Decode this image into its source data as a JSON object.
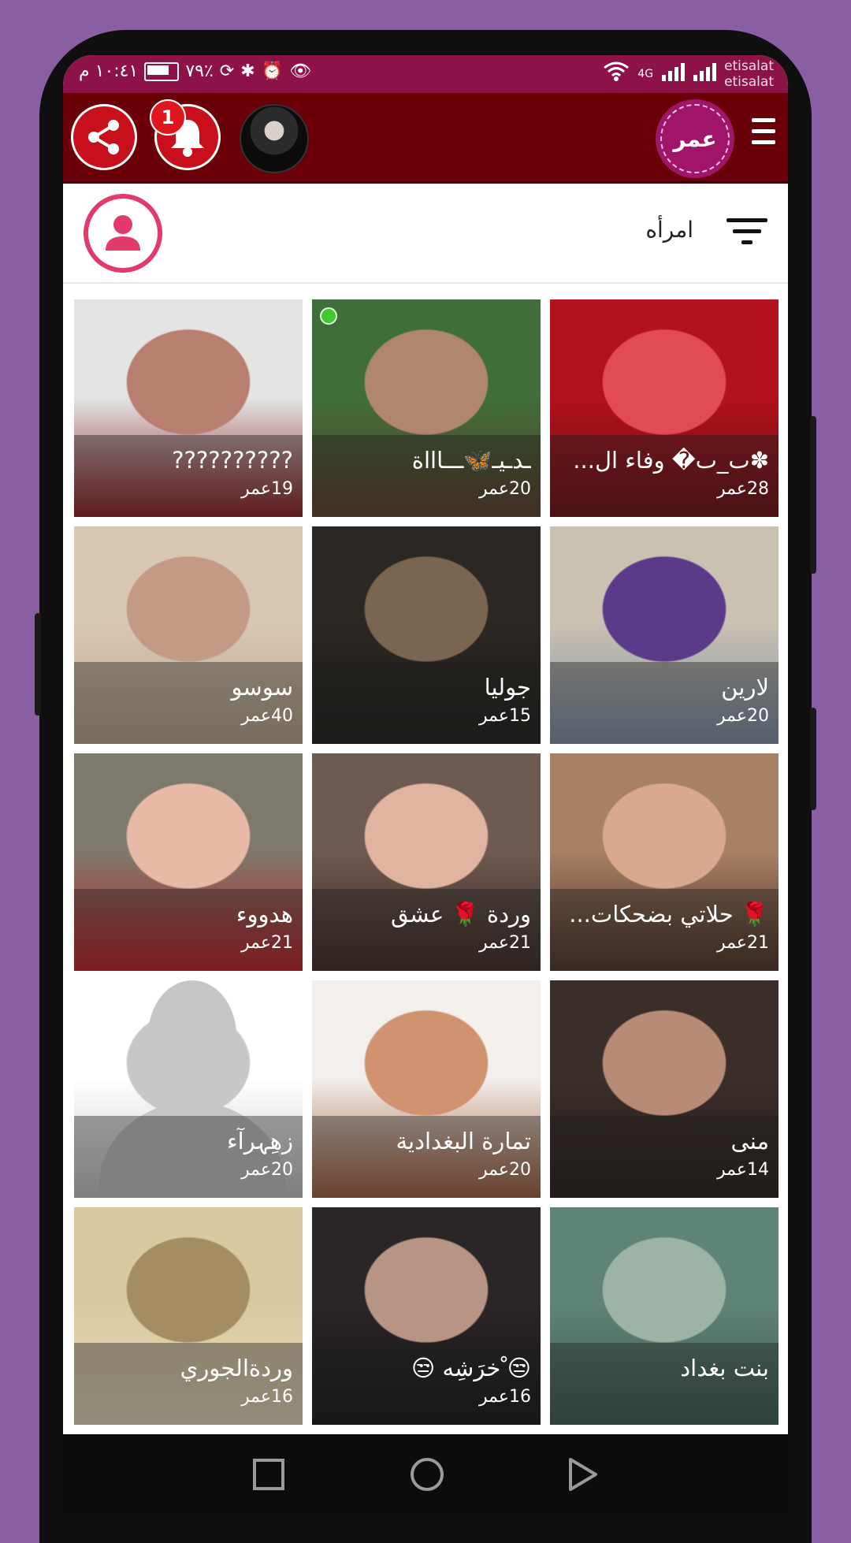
{
  "status_bar": {
    "time": "١٠:٤١ م",
    "battery": "٧٩٪",
    "network": "4G",
    "carriers": [
      "etisalat",
      "etisalat"
    ]
  },
  "header": {
    "brand": "عمر",
    "notification_count": "1"
  },
  "filter": {
    "label": "امرأه"
  },
  "age_suffix": "عمر",
  "profiles": [
    {
      "name": "✽ٮ_ٮ� وفاء ال...",
      "age": "28عمر",
      "colors": [
        "#b2121d",
        "#e24a55",
        "#6b0a0f"
      ]
    },
    {
      "name": "ـدـيـ🦋ـــاااة",
      "age": "20عمر",
      "colors": [
        "#3f6e3a",
        "#b08670",
        "#5a3b2a"
      ],
      "online": true
    },
    {
      "name": "??????????",
      "age": "19عمر",
      "colors": [
        "#e4e4e4",
        "#b87f70",
        "#8a1a1e"
      ]
    },
    {
      "name": "لارين",
      "age": "20عمر",
      "colors": [
        "#c9c1b2",
        "#5b3a8a",
        "#7d8fa4"
      ]
    },
    {
      "name": "جوليا",
      "age": "15عمر",
      "colors": [
        "#2b2722",
        "#7a6650",
        "#1c1a17"
      ]
    },
    {
      "name": "سوسو",
      "age": "40عمر",
      "colors": [
        "#d8c7b3",
        "#c39a85",
        "#b9a78d"
      ]
    },
    {
      "name": "🌹 حلاتي بضحكات...",
      "age": "21عمر",
      "colors": [
        "#a88066",
        "#d9a88e",
        "#4a3125"
      ]
    },
    {
      "name": "وردة 🌹 عشق",
      "age": "21عمر",
      "colors": [
        "#6d5a52",
        "#e0b4a0",
        "#3b2722"
      ]
    },
    {
      "name": "هدووء",
      "age": "21عمر",
      "colors": [
        "#7d7a6d",
        "#e8b9a7",
        "#c21c22"
      ]
    },
    {
      "name": "منى",
      "age": "14عمر",
      "colors": [
        "#3a2e2a",
        "#b88b77",
        "#241a17"
      ]
    },
    {
      "name": "تمارة البغدادية",
      "age": "20عمر",
      "colors": [
        "#f2efec",
        "#d0936f",
        "#a05c3a"
      ]
    },
    {
      "name": "زِهِہرآء",
      "age": "20عمر",
      "placeholder": true,
      "colors": [
        "#ffffff",
        "#c7c7c7",
        "#c7c7c7"
      ]
    },
    {
      "name": "بنت بغداد",
      "age": "",
      "colors": [
        "#5f8376",
        "#9cb3a6",
        "#3f5b50"
      ]
    },
    {
      "name": "😒 ْخرَشِه 😒",
      "age": "16عمر",
      "colors": [
        "#2a2526",
        "#b89484",
        "#151214"
      ]
    },
    {
      "name": "وردةالجوري",
      "age": "16عمر",
      "colors": [
        "#d9c9a0",
        "#a58d62",
        "#e6dbbd"
      ]
    }
  ]
}
